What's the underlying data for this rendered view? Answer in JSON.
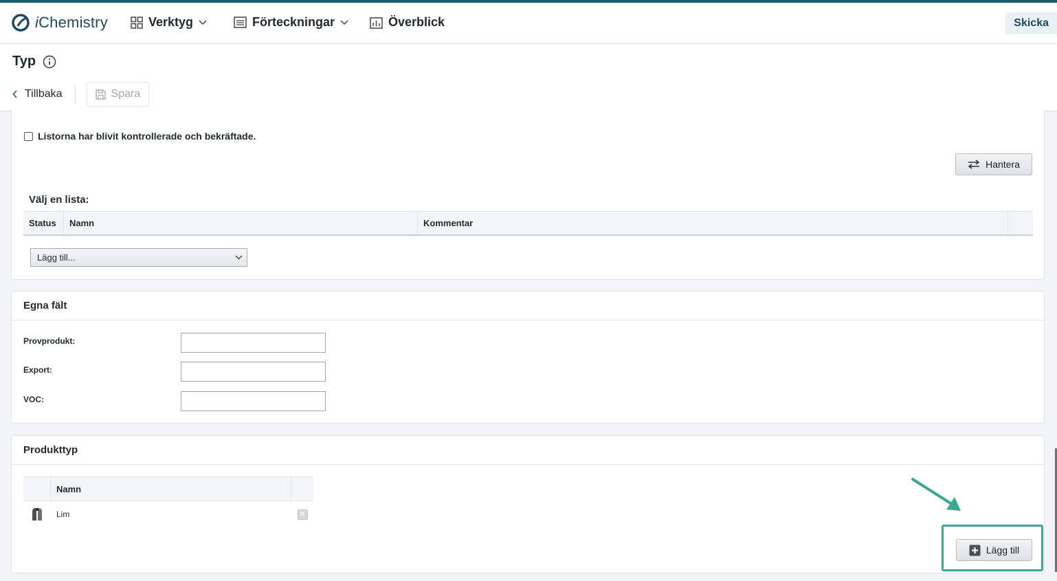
{
  "app": {
    "logo_prefix": "i",
    "logo_name": "Chemistry",
    "nav": [
      {
        "label": "Verktyg",
        "icon": "grid-icon",
        "has_dropdown": true
      },
      {
        "label": "Förteckningar",
        "icon": "list-icon",
        "has_dropdown": true
      },
      {
        "label": "Överblick",
        "icon": "chart-icon",
        "has_dropdown": false
      }
    ],
    "send_label": "Skicka",
    "accent_color": "#1d5a6d"
  },
  "page": {
    "title": "Typ",
    "back_label": "Tillbaka",
    "save_label": "Spara"
  },
  "lists_card": {
    "checkbox_label": "Listorna har blivit kontrollerade och bekräftade.",
    "checkbox_checked": false,
    "manage_label": "Hantera",
    "section_label": "Välj en lista:",
    "columns": [
      "Status",
      "Namn",
      "Kommentar"
    ],
    "add_select_value": "Lägg till..."
  },
  "custom_fields": {
    "title": "Egna fält",
    "fields": [
      {
        "label": "Provprodukt:",
        "value": ""
      },
      {
        "label": "Export:",
        "value": ""
      },
      {
        "label": "VOC:",
        "value": ""
      }
    ]
  },
  "product_type": {
    "title": "Produkttyp",
    "column_name": "Namn",
    "rows": [
      {
        "name": "Lim",
        "icon": "glue-tube-icon"
      }
    ],
    "add_label": "Lägg till"
  },
  "annotation": {
    "color": "#3aa892"
  }
}
